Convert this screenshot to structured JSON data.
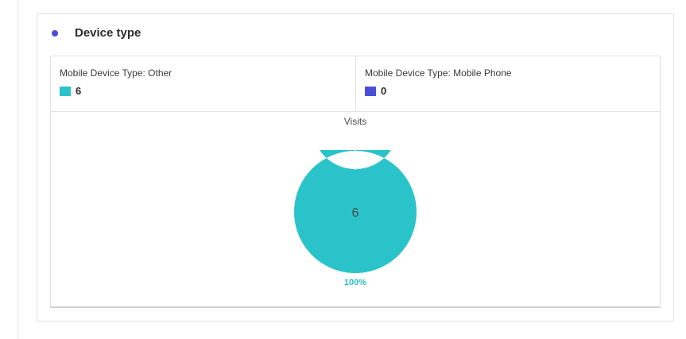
{
  "panel": {
    "title": "Device type",
    "bullet_color": "#4b4fd6"
  },
  "chart_data": {
    "type": "pie",
    "style": "donut",
    "metric": "Visits",
    "total_label": "6",
    "series": [
      {
        "name": "Mobile Device Type: Other",
        "value": 6,
        "display": "6",
        "color": "#2ac3c9",
        "percent_label": "100%"
      },
      {
        "name": "Mobile Device Type: Mobile Phone",
        "value": 0,
        "display": "0",
        "color": "#4b4fd6"
      }
    ]
  }
}
